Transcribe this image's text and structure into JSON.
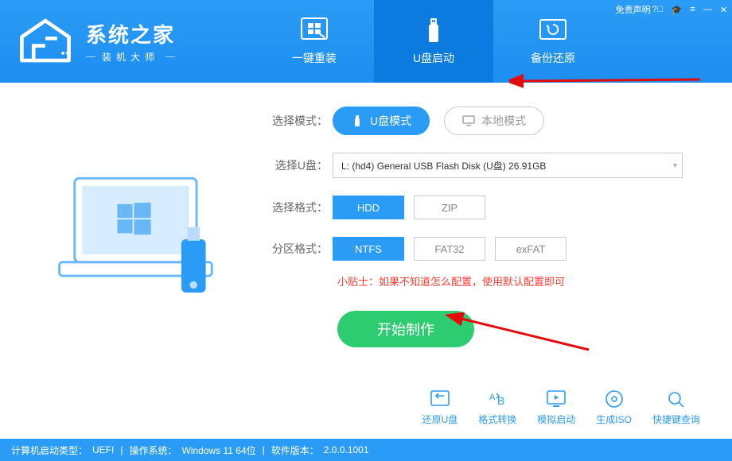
{
  "app": {
    "title": "系统之家",
    "subtitle": "装机大师"
  },
  "titlebar": {
    "disclaimer": "免责声明"
  },
  "tabs": {
    "reinstall": "一键重装",
    "usb_boot": "U盘启动",
    "backup": "备份还原"
  },
  "form": {
    "mode_label": "选择模式",
    "mode_usb": "U盘模式",
    "mode_local": "本地模式",
    "usb_label": "选择U盘",
    "usb_value": "L: (hd4) General USB Flash Disk  (U盘) 26.91GB",
    "format_label": "选择格式",
    "format_hdd": "HDD",
    "format_zip": "ZIP",
    "partition_label": "分区格式",
    "p_ntfs": "NTFS",
    "p_fat32": "FAT32",
    "p_exfat": "exFAT",
    "tip": "小贴士：如果不知道怎么配置，使用默认配置即可",
    "start": "开始制作"
  },
  "quick": {
    "restore": "还原U盘",
    "convert": "格式转换",
    "simulate": "模拟启动",
    "iso": "生成ISO",
    "shortcut": "快捷键查询"
  },
  "status": {
    "boot_type_label": "计算机启动类型：",
    "boot_type": "UEFI",
    "os_label": "操作系统：",
    "os": "Windows 11 64位",
    "version_label": "软件版本：",
    "version": "2.0.0.1001"
  }
}
